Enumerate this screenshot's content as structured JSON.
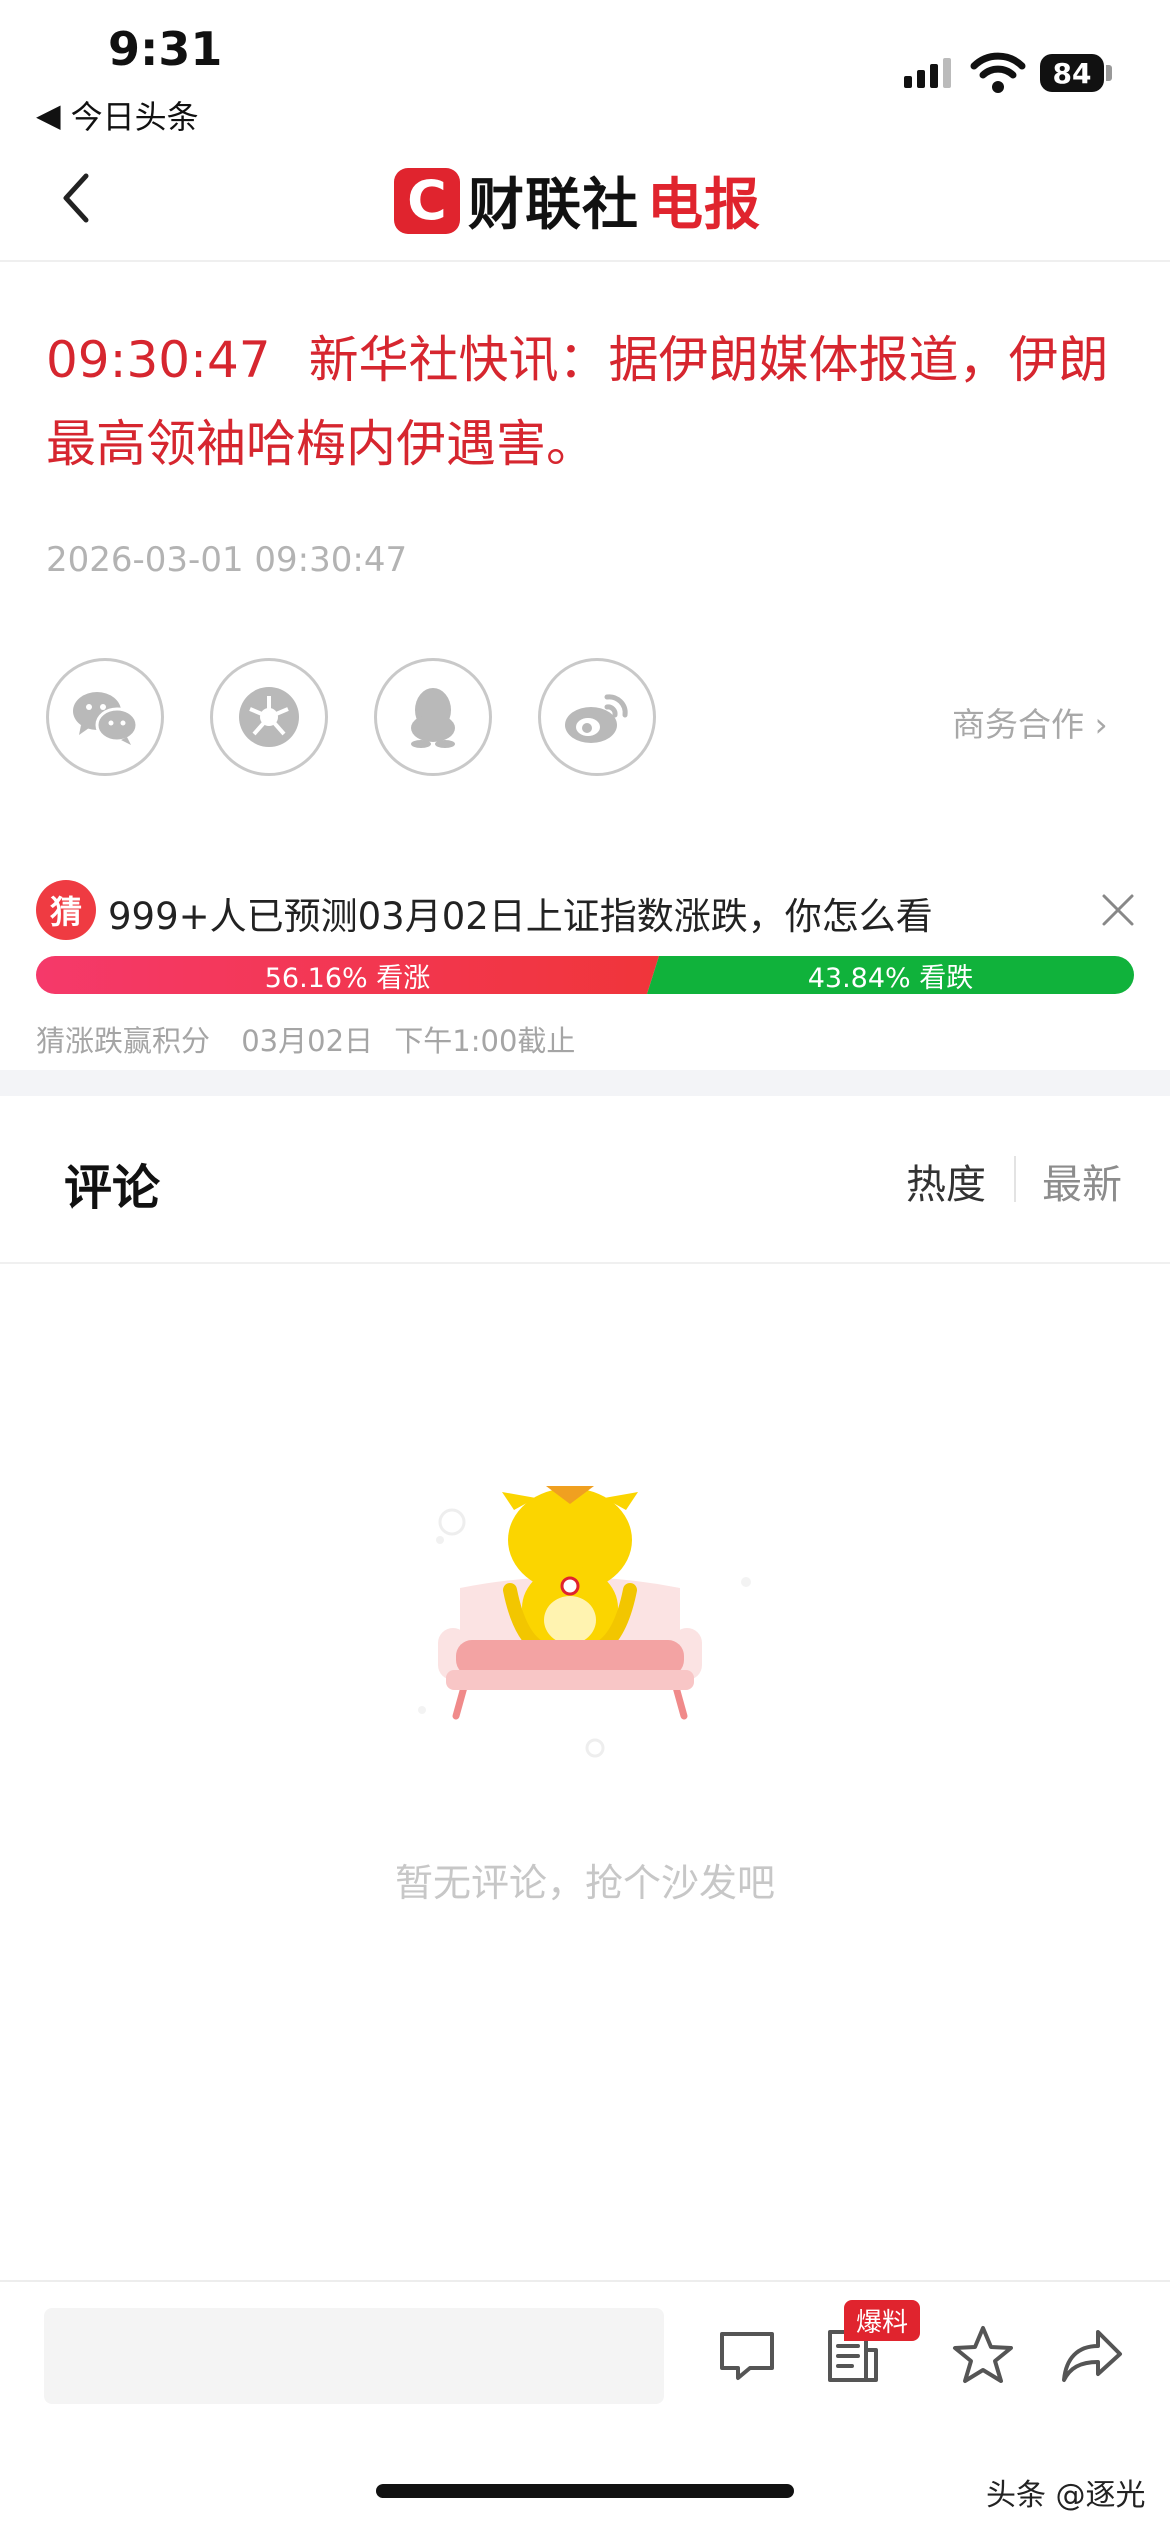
{
  "status_bar": {
    "time": "9:31",
    "back_app": "今日头条",
    "battery": "84"
  },
  "header": {
    "logo_mark": "C",
    "logo_black": "财联社",
    "logo_red": "电报"
  },
  "article": {
    "time": "09:30:47",
    "text": "新华社快讯：据伊朗媒体报道，伊朗最高领袖哈梅内伊遇害。",
    "datetime": "2026-03-01 09:30:47"
  },
  "share": {
    "items": [
      "wechat-icon",
      "moments-icon",
      "qq-icon",
      "weibo-icon"
    ],
    "business": "商务合作 ›"
  },
  "prediction": {
    "badge": "猜",
    "question": "999+人已预测03月02日上证指数涨跌，你怎么看",
    "up_label": "56.16% 看涨",
    "down_label": "43.84% 看跌",
    "up_fraction": 0.5616,
    "note_left": "猜涨跌赢积分",
    "note_date": "03月02日",
    "note_deadline": "下午1:00截止"
  },
  "comments": {
    "title": "评论",
    "sort_hot": "热度",
    "sort_new": "最新",
    "empty_text": "暂无评论，抢个沙发吧"
  },
  "bottom_bar": {
    "tip_badge": "爆料"
  },
  "watermark": "头条 @逐光",
  "colors": {
    "brand_red": "#e0242e",
    "headline_red": "#d6262f",
    "up_red": "#f0353a",
    "down_green": "#10b23b"
  }
}
